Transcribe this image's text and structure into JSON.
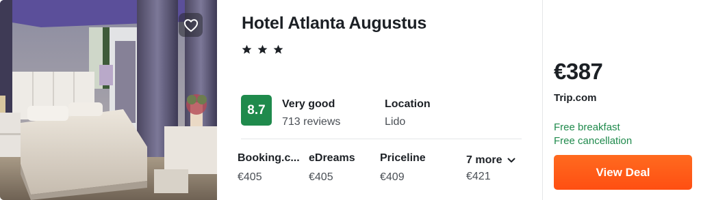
{
  "hotel": {
    "name": "Hotel Atlanta Augustus",
    "stars": 3,
    "image_icon": "heart-icon"
  },
  "rating": {
    "score": "8.7",
    "label": "Very good",
    "reviews": "713 reviews",
    "badge_color": "#1f8a4c"
  },
  "location": {
    "title": "Location",
    "value": "Lido"
  },
  "providers": [
    {
      "name": "Booking.c...",
      "price": "€405"
    },
    {
      "name": "eDreams",
      "price": "€405"
    },
    {
      "name": "Priceline",
      "price": "€409"
    }
  ],
  "more": {
    "label": "7 more",
    "price": "€421",
    "icon": "chevron-down-icon"
  },
  "deal": {
    "price": "€387",
    "site": "Trip.com",
    "perks": [
      "Free breakfast",
      "Free cancellation"
    ],
    "perk_color": "#1f8a4c",
    "button_label": "View Deal",
    "button_color": "#ff5a16"
  }
}
